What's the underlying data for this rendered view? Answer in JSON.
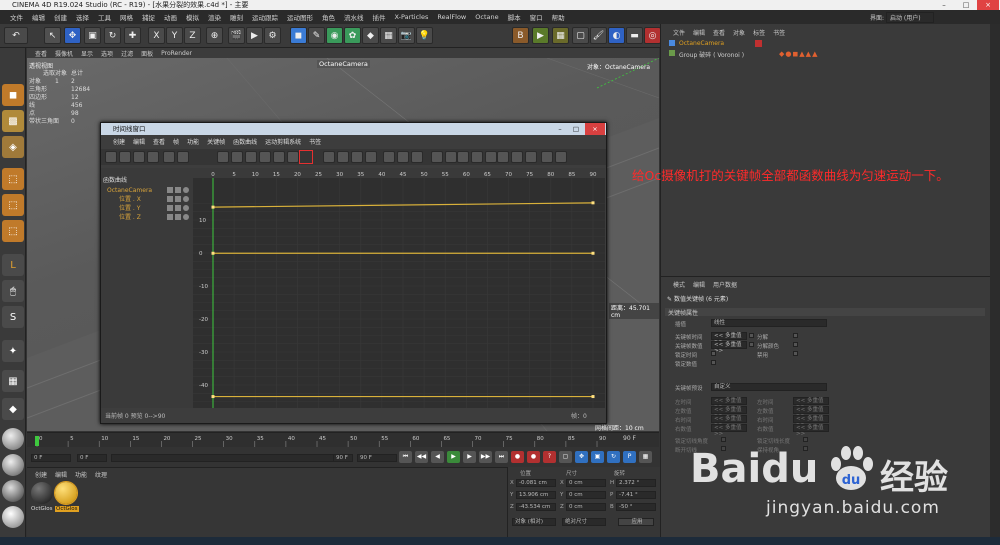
{
  "window": {
    "title": "CINEMA 4D R19.024 Studio (RC - R19) - [水果分裂的效果.c4d *] - 主要",
    "layout_label": "界面:",
    "layout_value": "启动 (用户)"
  },
  "menus": [
    "文件",
    "编辑",
    "创建",
    "选择",
    "工具",
    "网格",
    "捕捉",
    "动画",
    "模拟",
    "渲染",
    "雕刻",
    "运动跟踪",
    "运动图形",
    "角色",
    "流水线",
    "插件",
    "X-Particles",
    "RealFlow",
    "Octane",
    "脚本",
    "窗口",
    "帮助"
  ],
  "viewport": {
    "menu": [
      "查看",
      "摄像机",
      "显示",
      "选项",
      "过滤",
      "面板",
      "ProRender"
    ],
    "camera_label": "OctaneCamera",
    "object_label": "对象：OctaneCamera",
    "distance": "距离：45.701 cm",
    "grid": "网格间距：10 cm",
    "stats_header": [
      "选取对象",
      "总计"
    ],
    "stats_rows": [
      [
        "对象",
        "1",
        "2"
      ],
      [
        "三角形",
        "",
        "12684"
      ],
      [
        "四边形",
        "",
        "12"
      ],
      [
        "线",
        "",
        "456"
      ],
      [
        "点",
        "",
        "98"
      ],
      [
        "带状三角面",
        "",
        "0"
      ]
    ],
    "view_name": "透视视图"
  },
  "timeline_window": {
    "title": "时间线窗口",
    "menu": [
      "创建",
      "编辑",
      "查看",
      "帧",
      "功能",
      "关键帧",
      "函数曲线",
      "运动剪辑系统",
      "书签"
    ],
    "tree_header": "函数曲线",
    "tree": [
      {
        "label": "OctaneCamera",
        "color": "#d9a43a"
      },
      {
        "label": "位置 . X",
        "color": "#d9a43a"
      },
      {
        "label": "位置 . Y",
        "color": "#d9a43a"
      },
      {
        "label": "位置 . Z",
        "color": "#d9a43a"
      }
    ],
    "frame_ticks": [
      "0",
      "5",
      "10",
      "15",
      "20",
      "25",
      "30",
      "35",
      "40",
      "45",
      "50",
      "55",
      "60",
      "65",
      "70",
      "75",
      "80",
      "85",
      "90"
    ],
    "value_ticks": [
      "10",
      "0",
      "-10",
      "-20",
      "-30",
      "-40"
    ],
    "status_left": "当前帧 0 预览 0-->90",
    "status_right": "帧：0",
    "cursor_label": "0 F"
  },
  "timeline": {
    "ticks": [
      "0",
      "5",
      "10",
      "15",
      "20",
      "25",
      "30",
      "35",
      "40",
      "45",
      "50",
      "55",
      "60",
      "65",
      "70",
      "75",
      "80",
      "85",
      "90"
    ],
    "current": "0 F",
    "start": "0 F",
    "end": "90 F",
    "end2": "90 F",
    "end_label": "90 F",
    "fields_top": [
      "0 F",
      "90 F"
    ]
  },
  "material": {
    "menu": [
      "创建",
      "编辑",
      "功能",
      "纹理"
    ],
    "items": [
      "OctGlos",
      "OctGlos"
    ]
  },
  "coords": {
    "headers": [
      "位置",
      "尺寸",
      "旋转"
    ],
    "rows": [
      {
        "axis": "X",
        "pos": "-0.081 cm",
        "size": "0 cm",
        "rot_axis": "H",
        "rot": "2.372 °"
      },
      {
        "axis": "Y",
        "pos": "13.906 cm",
        "size": "0 cm",
        "rot_axis": "P",
        "rot": "-7.41 °"
      },
      {
        "axis": "Z",
        "pos": "-43.534 cm",
        "size": "0 cm",
        "rot_axis": "B",
        "rot": "-50 °"
      }
    ],
    "mode": "对象 (相对)",
    "size_mode": "绝对尺寸",
    "apply": "应用"
  },
  "objects": {
    "menu": [
      "文件",
      "编辑",
      "查看",
      "对象",
      "标签",
      "书签"
    ],
    "items": [
      "OctaneCamera",
      "Group 破碎 ( Voronoi )"
    ]
  },
  "attributes": {
    "menu": [
      "模式",
      "编辑",
      "用户数据"
    ],
    "title": "数值关键帧 (6 元素)",
    "section": "关键帧属性",
    "interp_label": "插值",
    "interp_value": "线性",
    "left_fields": [
      "关键帧时间",
      "关键帧数值",
      "锁定时间",
      "锁定数值"
    ],
    "mixed": "<< 多重值>>",
    "right_fields": [
      "分解",
      "分解颜色",
      "禁用"
    ],
    "preset_label": "关键帧预设",
    "preset_value": "自定义",
    "tangent_left": [
      "左时间",
      "左数值",
      "右时间",
      "右数值"
    ],
    "tangent_right": [
      "左时间",
      "左数值",
      "右时间",
      "右数值"
    ],
    "bottom": [
      "锁定切线角度",
      "锁定切线长度",
      "断开切线",
      "保持视角"
    ]
  },
  "annotation": "给Oc摄像机打的关键帧全部都函数曲线为匀速运动一下。",
  "watermark": {
    "brand": "Baidu",
    "brand_cn": "经验",
    "url": "jingyan.baidu.com"
  },
  "colors": {
    "annotation": "#ff2a2a",
    "curve": "#d9b13a",
    "baidu_blue": "#2d63d3"
  }
}
